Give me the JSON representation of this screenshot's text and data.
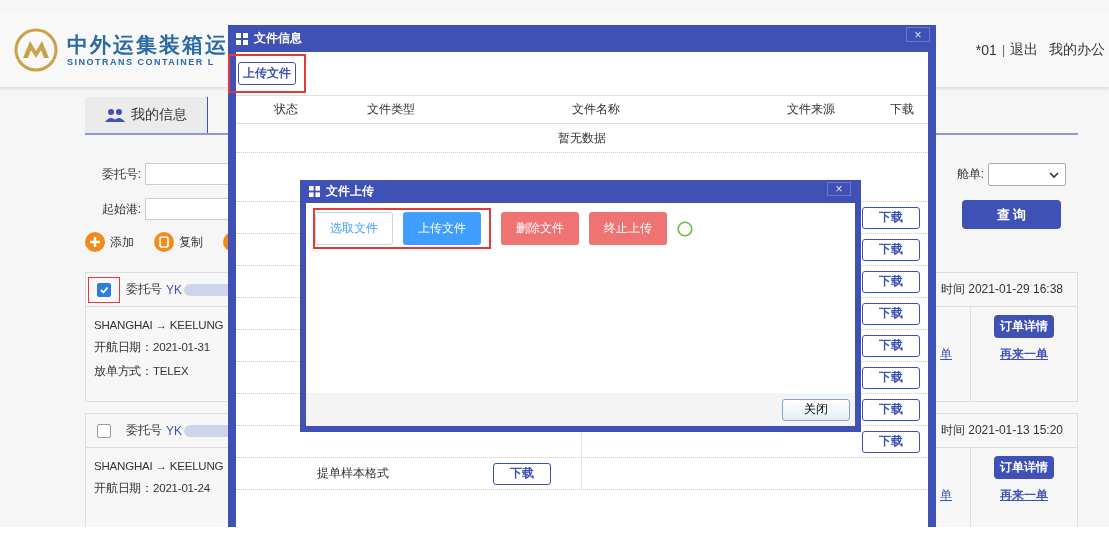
{
  "header": {
    "logo_title": "中外运集装箱运",
    "logo_subtitle": "SINOTRANS CONTAINER L",
    "user": "*01",
    "separator": "|",
    "logout": "退出",
    "office": "我的办公"
  },
  "tabs": [
    {
      "label": "我的信息",
      "selected": true
    }
  ],
  "filters": [
    {
      "label": "委托号:"
    },
    {
      "label": "起始港:"
    }
  ],
  "manifest": {
    "label": "舱单:"
  },
  "search_button": "查 询",
  "actions": [
    {
      "label": "添加",
      "kind": "add"
    },
    {
      "label": "复制",
      "kind": "copy"
    },
    {
      "kind": "other"
    }
  ],
  "orders": [
    {
      "checked": true,
      "number_label": "委托号",
      "number": "YK",
      "route": "SHANGHAI → KEELUNG",
      "sail_date": "开航日期：2021-01-31",
      "release": "放单方式：TELEX",
      "time": "时间 2021-01-29 16:38",
      "link": "单",
      "detail_button": "订单详情",
      "reorder": "再来一单"
    },
    {
      "checked": false,
      "number_label": "委托号",
      "number": "YK",
      "route": "SHANGHAI → KEELUNG",
      "sail_date": "开航日期：2021-01-24",
      "time": "时间 2021-01-13 15:20",
      "link": "单",
      "detail_button": "订单详情",
      "reorder": "再来一单"
    }
  ],
  "file_dialog": {
    "title": "文件信息",
    "close": "×",
    "upload_button": "上传文件",
    "columns": [
      "状态",
      "文件类型",
      "文件名称",
      "文件来源",
      "下载"
    ],
    "empty_text": "暂无数据",
    "template_rows": [
      {
        "right_download": "下载"
      },
      {
        "right_download": "下载"
      },
      {
        "right_download": "下载"
      },
      {
        "right_download": "下载"
      },
      {
        "right_download": "下载"
      },
      {
        "right_download": "下载"
      },
      {
        "right_download": "下载"
      },
      {
        "right_download": "下载"
      },
      {
        "left_name": "提单样本格式",
        "left_download": "下载"
      }
    ]
  },
  "upload_dialog": {
    "title": "文件上传",
    "close": "×",
    "buttons": [
      {
        "label": "选取文件",
        "kind": "select"
      },
      {
        "label": "上传文件",
        "kind": "upload"
      },
      {
        "label": "删除文件",
        "kind": "delete"
      },
      {
        "label": "终止上传",
        "kind": "stop"
      }
    ],
    "close_button": "关闭"
  }
}
